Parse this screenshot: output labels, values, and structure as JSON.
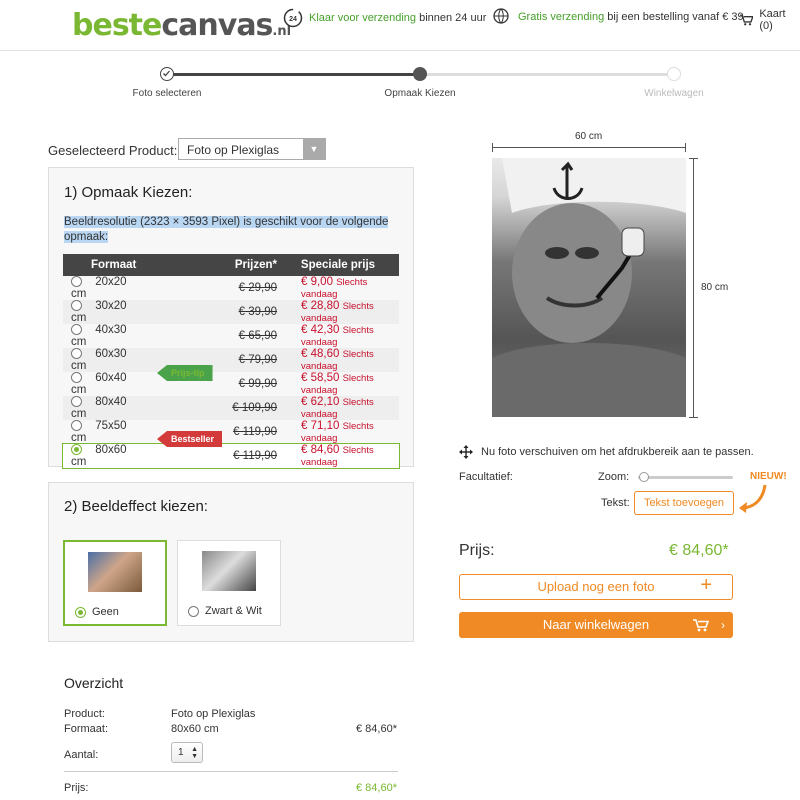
{
  "header": {
    "logo": {
      "part1": "beste",
      "part2": "canvas",
      "tld": ".nl"
    },
    "usp1": {
      "icon": "24h-clock-icon",
      "highlight": "Klaar voor verzending",
      "rest": "binnen 24 uur"
    },
    "usp2": {
      "icon": "globe-truck-icon",
      "highlight": "Gratis verzending",
      "rest": "bij een bestelling vanaf € 39"
    },
    "cart": {
      "icon": "cart-icon",
      "label": "Kaart (0)"
    }
  },
  "steps": [
    {
      "label": "Foto selecteren",
      "state": "done"
    },
    {
      "label": "Opmaak Kiezen",
      "state": "current"
    },
    {
      "label": "Winkelwagen",
      "state": "todo"
    }
  ],
  "product": {
    "label": "Geselecteerd Product:",
    "value": "Foto op Plexiglas"
  },
  "section1": {
    "title": "1) Opmaak Kiezen:",
    "resolution": "Beeldresolutie (2323 × 3593 Pixel) is geschikt voor de volgende opmaak:",
    "headers": [
      "Formaat",
      "Prijzen*",
      "Speciale prijs"
    ],
    "today": "Slechts vandaag",
    "rows": [
      {
        "size": "20x20 cm",
        "old": "€ 29,90",
        "new": "€ 9,00"
      },
      {
        "size": "30x20 cm",
        "old": "€ 39,90",
        "new": "€ 28,80"
      },
      {
        "size": "40x30 cm",
        "old": "€ 65,90",
        "new": "€ 42,30"
      },
      {
        "size": "60x30 cm",
        "old": "€ 79,90",
        "new": "€ 48,60"
      },
      {
        "size": "60x40 cm",
        "old": "€ 99,90",
        "new": "€ 58,50"
      },
      {
        "size": "80x40 cm",
        "old": "€ 109,90",
        "new": "€ 62,10"
      },
      {
        "size": "75x50 cm",
        "old": "€ 119,90",
        "new": "€ 71,10"
      },
      {
        "size": "80x60 cm",
        "old": "€ 119,90",
        "new": "€ 84,60"
      }
    ],
    "tag_price": "Prijs-tip",
    "tag_best": "Bestseller"
  },
  "section2": {
    "title": "2) Beeldeffect kiezen:",
    "options": [
      {
        "label": "Geen"
      },
      {
        "label": "Zwart & Wit"
      }
    ]
  },
  "overview": {
    "title": "Overzicht",
    "product_label": "Product:",
    "product_value": "Foto op Plexiglas",
    "format_label": "Formaat:",
    "format_value": "80x60 cm",
    "format_price": "€ 84,60*",
    "qty_label": "Aantal:",
    "qty_value": "1",
    "price_label": "Prijs:",
    "price_value": "€ 84,60*"
  },
  "preview": {
    "width_label": "60 cm",
    "height_label": "80 cm",
    "move_hint": "Nu foto verschuiven om het afdrukbereik aan te passen.",
    "optional_label": "Facultatief:",
    "zoom_label": "Zoom:",
    "zoom_value": 0.03,
    "text_label": "Tekst:",
    "text_button": "Tekst toevoegen",
    "new_badge": "NIEUW!"
  },
  "order": {
    "price_label": "Prijs:",
    "price_value": "€ 84,60*",
    "upload_button": "Upload nog een foto",
    "upload_icon": "plus-icon",
    "cart_button": "Naar winkelwagen",
    "cart_icon": "cart-icon"
  },
  "colors": {
    "green": "#7ab833",
    "orange": "#f08a24",
    "red": "#c8102e",
    "header_dark": "#454545"
  }
}
